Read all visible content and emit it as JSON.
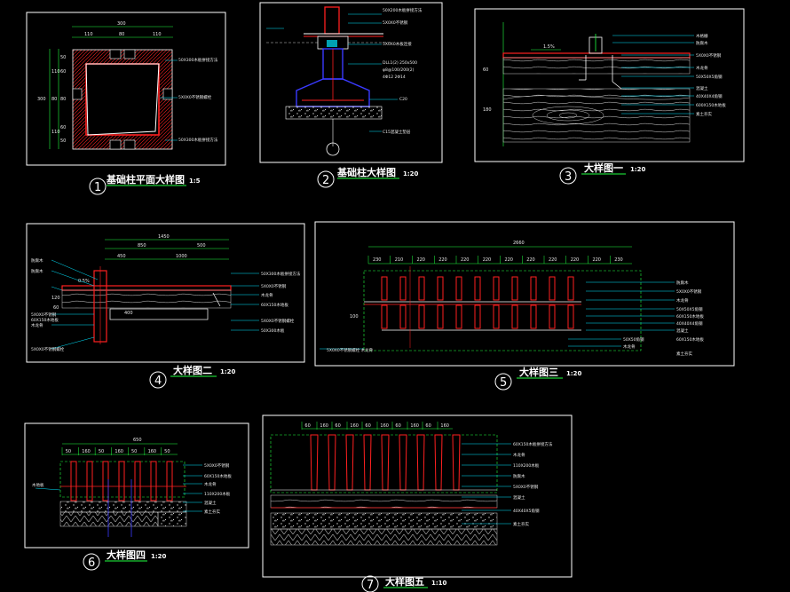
{
  "colors": {
    "background": "#000000",
    "frame": "#ffffff",
    "structure": "#ff2020",
    "dimension": "#20ff40",
    "label": "#e8e8e8",
    "soil": "#cfcfcf",
    "cyan": "#00e5ff",
    "blue": "#3a3aff"
  },
  "details": [
    {
      "number": "1",
      "title": "基础柱平面大样图",
      "scale": "1:5",
      "dims_top": [
        "300"
      ],
      "dims_top2": [
        "110",
        "80",
        "110"
      ],
      "dims_left_outer": [
        "300"
      ],
      "dims_left": [
        "110",
        "80",
        "110"
      ],
      "dims_left_inner": [
        "50",
        "60",
        "60",
        "80",
        "60",
        "50"
      ],
      "labels": [
        "50X300木板拼接方法",
        "5X0X0不锈钢螺栓",
        "50X300木板拼接方法"
      ]
    },
    {
      "number": "2",
      "title": "基础柱大样图",
      "scale": "1:20",
      "labels": [
        "50X200木板拼接方法",
        "5X0X0不锈钢",
        "5X0X0木板连接",
        "DLL1(2) 250x500",
        "φ8@100/200(2)",
        "4Φ12 2Φ14",
        "C20",
        "C15混凝土垫层"
      ]
    },
    {
      "number": "3",
      "title": "大样图一",
      "scale": "1:20",
      "dims": [
        "1.5%"
      ],
      "dims_left": [
        "60",
        "180"
      ],
      "labels": [
        "木格栅",
        "防腐木",
        "5X0X0不锈钢",
        "木龙骨",
        "50X50X5角钢",
        "混凝土",
        "40X40X4角钢",
        "600X150木地板",
        "素土夯实"
      ]
    },
    {
      "number": "4",
      "title": "大样图二",
      "scale": "1:20",
      "dims_top": [
        "1450"
      ],
      "dims_top2": [
        "850",
        "500"
      ],
      "dims_top3": [
        "450",
        "1000"
      ],
      "dims_left": [
        "120",
        "60"
      ],
      "dims_mid": [
        "0.5%",
        "400"
      ],
      "labels_left": [
        "防腐木",
        "防腐木",
        "5X0X0不锈钢",
        "60X150木地板",
        "木龙骨",
        "5X0X0不锈钢螺栓"
      ],
      "labels_right": [
        "50X300木板拼接方法",
        "5X0X0不锈钢",
        "木龙骨",
        "60X150木地板",
        "5X0X0不锈钢螺栓",
        "50X300木板"
      ]
    },
    {
      "number": "5",
      "title": "大样图三",
      "scale": "1:20",
      "dims_top": [
        "2660"
      ],
      "dims_top2": [
        "230",
        "210",
        "220",
        "220",
        "220",
        "220",
        "220",
        "220",
        "220",
        "220",
        "220",
        "230"
      ],
      "dims_left": [
        "100"
      ],
      "labels": [
        "防腐木",
        "5X0X0不锈钢",
        "木龙骨",
        "50X50X5角钢",
        "60X150木地板",
        "40X40X4角钢",
        "混凝土",
        "50X50角钢",
        "木龙骨",
        "60X150木地板",
        "素土夯实"
      ],
      "label_bottom": "5X0X0不锈钢螺栓 木龙骨"
    },
    {
      "number": "6",
      "title": "大样图四",
      "scale": "1:20",
      "dims_top": [
        "650"
      ],
      "dims_top2": [
        "50",
        "160",
        "50",
        "160",
        "50",
        "160",
        "50"
      ],
      "side_label": "木地板",
      "labels": [
        "5X0X0不锈钢",
        "60X150木地板",
        "木龙骨",
        "110X200木板",
        "混凝土",
        "素土夯实"
      ]
    },
    {
      "number": "7",
      "title": "大样图五",
      "scale": "1:10",
      "dims_top": [
        "60",
        "160",
        "60",
        "160",
        "60",
        "160",
        "60",
        "160",
        "60",
        "160"
      ],
      "labels": [
        "60X150木板拼接方法",
        "木龙骨",
        "110X200木板",
        "防腐木",
        "5X0X0不锈钢",
        "混凝土",
        "40X40X5角钢",
        "素土夯实"
      ]
    }
  ]
}
